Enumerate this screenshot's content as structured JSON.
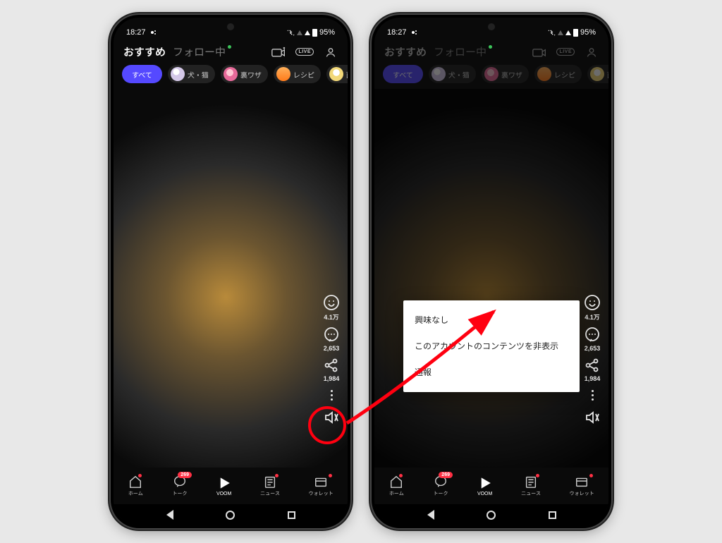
{
  "status": {
    "time": "18:27",
    "battery": "95%"
  },
  "header": {
    "tab_recommended": "おすすめ",
    "tab_following": "フォロー中"
  },
  "live_label": "LIVE",
  "categories": [
    {
      "label": "すべて",
      "active": true
    },
    {
      "label": "犬・猫",
      "avatar": "av1"
    },
    {
      "label": "裏ワザ",
      "avatar": "av2"
    },
    {
      "label": "レシピ",
      "avatar": "av3"
    },
    {
      "label": "面",
      "avatar": "av4"
    }
  ],
  "engagement": {
    "likes": "4.1万",
    "comments": "2,653",
    "shares": "1,984"
  },
  "popup": {
    "not_interested": "興味なし",
    "hide_account": "このアカウントのコンテンツを非表示",
    "report": "通報"
  },
  "nav": {
    "home": "ホーム",
    "talk": "トーク",
    "talk_badge": "269",
    "voom": "VOOM",
    "news": "ニュース",
    "wallet": "ウォレット"
  }
}
